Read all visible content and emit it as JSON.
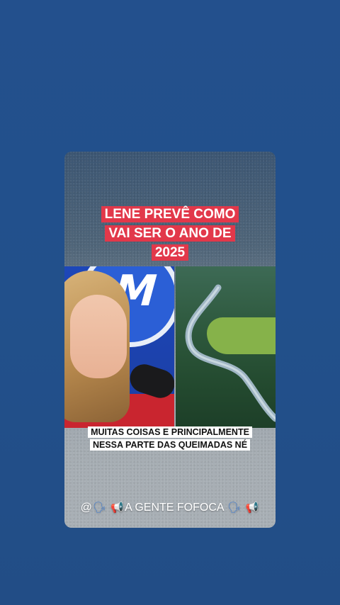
{
  "post": {
    "title": "LENE PREVÊ COMO VAI SER O ANO DE 2025",
    "caption": "MUITAS COISAS E PRINCIPALMENTE NESSA PARTE DAS QUEIMADAS NÉ",
    "footer": {
      "prefix": "@",
      "text": "A GENTE FOFOCA",
      "icons": [
        "speaking-head-icon",
        "megaphone-icon"
      ]
    }
  },
  "colors": {
    "page_background": "#224e8a",
    "title_highlight": "#e2384a",
    "caption_highlight": "#ffffff"
  },
  "glyphs": {
    "speaking_head": "🗣",
    "megaphone": "📢"
  }
}
